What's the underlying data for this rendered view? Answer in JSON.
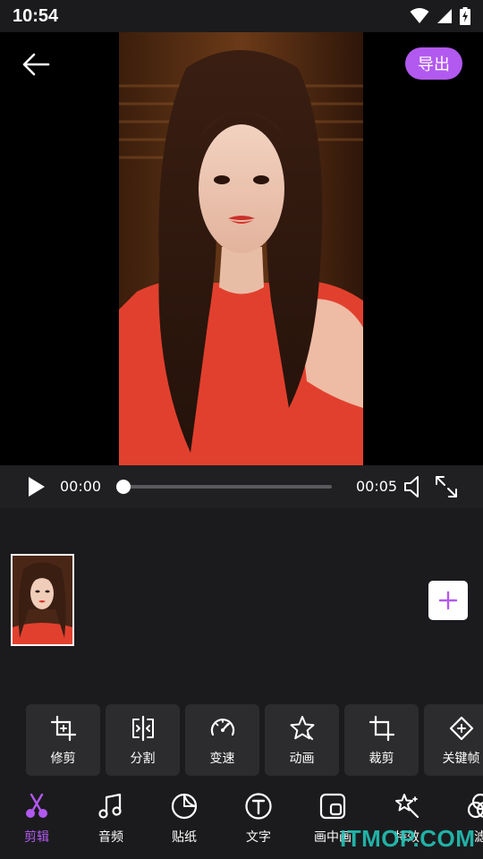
{
  "status_bar": {
    "time": "10:54"
  },
  "preview": {
    "export_label": "导出"
  },
  "player": {
    "current_time": "00:00",
    "total_time": "00:05",
    "progress": 0.0
  },
  "tools": [
    {
      "label": "修剪",
      "icon": "trim-icon"
    },
    {
      "label": "分割",
      "icon": "split-icon"
    },
    {
      "label": "变速",
      "icon": "speed-icon"
    },
    {
      "label": "动画",
      "icon": "animation-icon"
    },
    {
      "label": "裁剪",
      "icon": "crop-icon"
    },
    {
      "label": "关键帧",
      "icon": "keyframe-icon"
    }
  ],
  "bottom_nav": [
    {
      "label": "剪辑",
      "icon": "scissors-icon",
      "active": true
    },
    {
      "label": "音频",
      "icon": "music-icon",
      "active": false
    },
    {
      "label": "贴纸",
      "icon": "sticker-icon",
      "active": false
    },
    {
      "label": "文字",
      "icon": "text-icon",
      "active": false
    },
    {
      "label": "画中画",
      "icon": "picture-in-picture-icon",
      "active": false
    },
    {
      "label": "特效",
      "icon": "effects-icon",
      "active": false
    },
    {
      "label": "滤",
      "icon": "filter-icon",
      "active": false
    }
  ],
  "colors": {
    "accent": "#b259f0",
    "background": "#1b1b1d",
    "tile": "#2c2c2e"
  },
  "watermark": "ITMOP.COM"
}
